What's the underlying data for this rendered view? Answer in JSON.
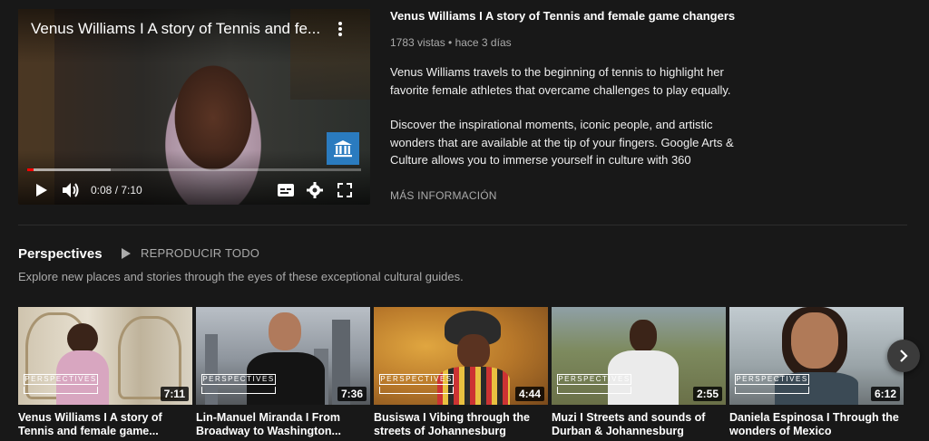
{
  "player": {
    "title": "Venus Williams I A story of Tennis and fe...",
    "time": "0:08 / 7:10",
    "progress_played": 0.019,
    "progress_buffered": 0.25
  },
  "video": {
    "title": "Venus Williams I A story of Tennis and female game changers",
    "meta": "1783 vistas • hace 3 días",
    "description_p1": "Venus Williams travels to the beginning of tennis to highlight her favorite female athletes that overcame challenges to play equally.",
    "description_p2": "Discover the inspirational moments, iconic people, and artistic wonders that are available at the tip of your fingers. Google Arts & Culture allows you to immerse yourself in culture with 360",
    "more_info": "MÁS INFORMACIÓN"
  },
  "shelf": {
    "title": "Perspectives",
    "play_all": "REPRODUCIR TODO",
    "description": "Explore new places and stories through the eyes of these exceptional cultural guides.",
    "badge": "PERSPECTIVES",
    "cards": [
      {
        "title": "Venus Williams I A story of Tennis and female game...",
        "duration": "7:11"
      },
      {
        "title": "Lin-Manuel Miranda I From Broadway to Washington...",
        "duration": "7:36"
      },
      {
        "title": "Busiswa I Vibing through the streets of Johannesburg",
        "duration": "4:44"
      },
      {
        "title": "Muzi I Streets and sounds of Durban & Johannesburg",
        "duration": "2:55"
      },
      {
        "title": "Daniela Espinosa I Through the wonders of Mexico",
        "duration": "6:12"
      }
    ]
  },
  "colors": {
    "background": "#181818",
    "progress_red": "#ff0000",
    "museum_blue": "#2a7bbf"
  }
}
